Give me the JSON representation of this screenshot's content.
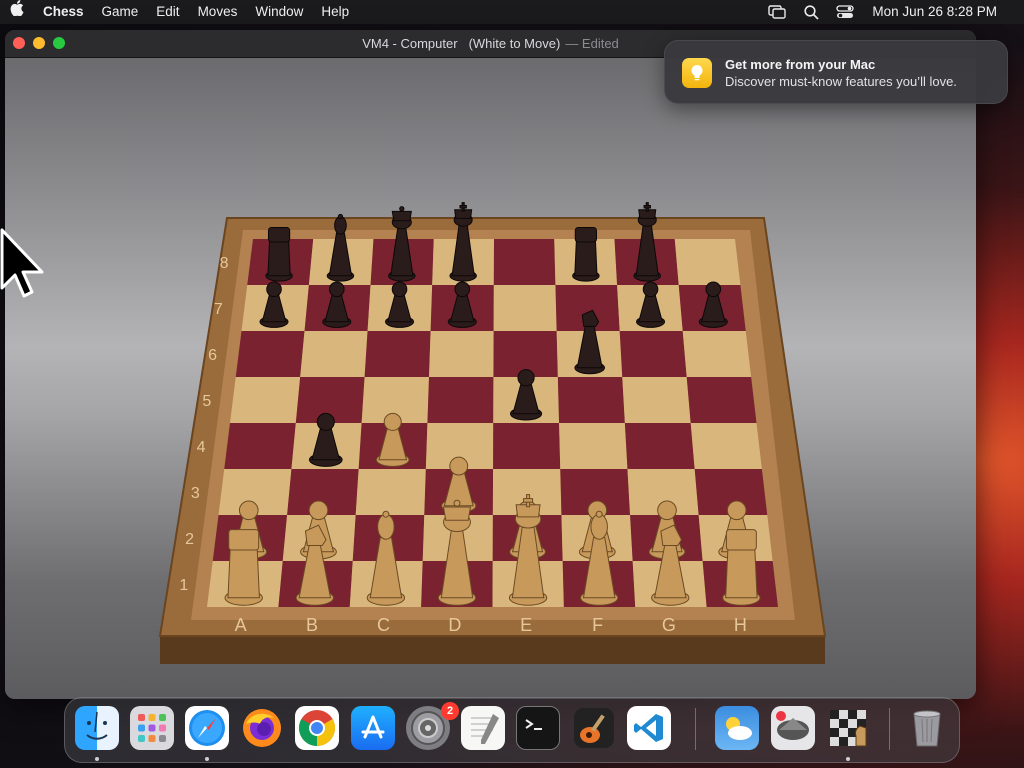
{
  "menubar": {
    "app_name": "Chess",
    "items": [
      "Game",
      "Edit",
      "Moves",
      "Window",
      "Help"
    ],
    "clock": "Mon Jun 26  8:28 PM"
  },
  "window": {
    "title": "VM4 - Computer",
    "subtitle": "(White to Move)",
    "edited": "— Edited"
  },
  "notification": {
    "title": "Get more from your Mac",
    "body": "Discover must-know features you’ll love."
  },
  "board": {
    "files": [
      "A",
      "B",
      "C",
      "D",
      "E",
      "F",
      "G",
      "H"
    ],
    "ranks": [
      "1",
      "2",
      "3",
      "4",
      "5",
      "6",
      "7",
      "8"
    ],
    "pieces": [
      {
        "sq": "a1",
        "c": "w",
        "t": "R"
      },
      {
        "sq": "b1",
        "c": "w",
        "t": "N"
      },
      {
        "sq": "c1",
        "c": "w",
        "t": "B"
      },
      {
        "sq": "d1",
        "c": "w",
        "t": "Q"
      },
      {
        "sq": "e1",
        "c": "w",
        "t": "K"
      },
      {
        "sq": "f1",
        "c": "w",
        "t": "B"
      },
      {
        "sq": "g1",
        "c": "w",
        "t": "N"
      },
      {
        "sq": "h1",
        "c": "w",
        "t": "R"
      },
      {
        "sq": "a2",
        "c": "w",
        "t": "P"
      },
      {
        "sq": "b2",
        "c": "w",
        "t": "P"
      },
      {
        "sq": "e2",
        "c": "w",
        "t": "P"
      },
      {
        "sq": "f2",
        "c": "w",
        "t": "P"
      },
      {
        "sq": "g2",
        "c": "w",
        "t": "P"
      },
      {
        "sq": "h2",
        "c": "w",
        "t": "P"
      },
      {
        "sq": "c4",
        "c": "w",
        "t": "P"
      },
      {
        "sq": "d3",
        "c": "w",
        "t": "P"
      },
      {
        "sq": "a8",
        "c": "b",
        "t": "R"
      },
      {
        "sq": "b8",
        "c": "b",
        "t": "B"
      },
      {
        "sq": "c8",
        "c": "b",
        "t": "Q"
      },
      {
        "sq": "d8",
        "c": "b",
        "t": "K"
      },
      {
        "sq": "f8",
        "c": "b",
        "t": "R"
      },
      {
        "sq": "g8",
        "c": "b",
        "t": "K"
      },
      {
        "sq": "a7",
        "c": "b",
        "t": "P"
      },
      {
        "sq": "b7",
        "c": "b",
        "t": "P"
      },
      {
        "sq": "c7",
        "c": "b",
        "t": "P"
      },
      {
        "sq": "d7",
        "c": "b",
        "t": "P"
      },
      {
        "sq": "g7",
        "c": "b",
        "t": "P"
      },
      {
        "sq": "h7",
        "c": "b",
        "t": "P"
      },
      {
        "sq": "f6",
        "c": "b",
        "t": "N"
      },
      {
        "sq": "e5",
        "c": "b",
        "t": "P"
      },
      {
        "sq": "b4",
        "c": "b",
        "t": "P"
      }
    ]
  },
  "dock": {
    "apps": [
      "Finder",
      "Launchpad",
      "Safari",
      "Firefox",
      "Chrome",
      "App Store",
      "System Settings",
      "TextEdit",
      "Terminal",
      "GarageBand",
      "VS Code",
      "Weather",
      "Migration Assistant",
      "Chess",
      "Trash"
    ],
    "settings_badge": "2"
  },
  "colors": {
    "light_square": "#d9b77c",
    "dark_square": "#7a2230",
    "frame": "#9a6c3c",
    "white_piece": "#c79a5c",
    "black_piece": "#2a1c1a"
  }
}
